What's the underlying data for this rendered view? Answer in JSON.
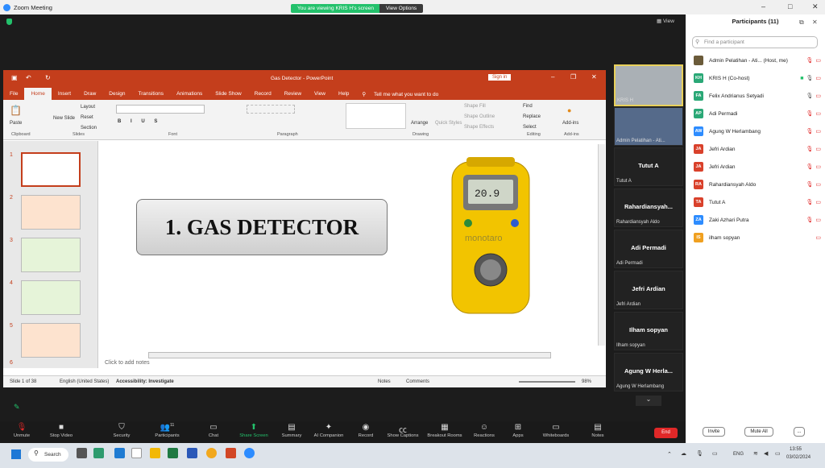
{
  "zoom": {
    "window_title": "Zoom Meeting",
    "banner": "You are viewing KRIS H's screen",
    "view_options": "View Options",
    "view_label": "View"
  },
  "ppt": {
    "title": "Gas Detector - PowerPoint",
    "sign_in": "Sign in",
    "tell_me": "Tell me what you want to do",
    "tabs": [
      "File",
      "Home",
      "Insert",
      "Draw",
      "Design",
      "Transitions",
      "Animations",
      "Slide Show",
      "Record",
      "Review",
      "View",
      "Help"
    ],
    "groups": [
      "Clipboard",
      "Slides",
      "Font",
      "Paragraph",
      "Drawing",
      "Editing",
      "Add-ins"
    ],
    "buttons": {
      "paste": "Paste",
      "new_slide": "New Slide",
      "layout": "Layout",
      "reset": "Reset",
      "section": "Section",
      "arrange": "Arrange",
      "quick_styles": "Quick Styles",
      "shape_fill": "Shape Fill",
      "shape_outline": "Shape Outline",
      "shape_effects": "Shape Effects",
      "find": "Find",
      "replace": "Replace",
      "select": "Select",
      "add_ins": "Add-ins"
    },
    "slide_numbers": [
      "1",
      "2",
      "3",
      "4",
      "5",
      "6"
    ],
    "slide_title": "1. GAS DETECTOR",
    "device_reading": "20.9",
    "device_brand": "monotaro",
    "notes_placeholder": "Click to add notes",
    "status": {
      "slide": "Slide 1 of 38",
      "language": "English (United States)",
      "accessibility": "Accessibility: Investigate",
      "notes": "Notes",
      "comments": "Comments",
      "zoom": "98%"
    }
  },
  "tiles": [
    {
      "label": "KRIS H"
    },
    {
      "label": "Admin Pelatihan - Ati..."
    },
    {
      "name": "Tutut A",
      "label": "Tutut A"
    },
    {
      "name": "Rahardiansyah...",
      "label": "Rahardiansyah Aldo"
    },
    {
      "name": "Adi Permadi",
      "label": "Adi Permadi"
    },
    {
      "name": "Jefri Ardian",
      "label": "Jefri Ardian"
    },
    {
      "name": "Ilham sopyan",
      "label": "Ilham sopyan"
    },
    {
      "name": "Agung W Herla...",
      "label": "Agung W Herlambang"
    }
  ],
  "participants": {
    "title": "Participants (11)",
    "search_placeholder": "Find a participant",
    "list": [
      {
        "initials": "",
        "name": "Admin Pelatihan - Ati...  (Host, me)",
        "color": "#6b5b3a"
      },
      {
        "initials": "KH",
        "name": "KRIS H (Co-host)",
        "color": "#2aa876"
      },
      {
        "initials": "FA",
        "name": "Felix Andrianus Setyadi",
        "color": "#2aa876"
      },
      {
        "initials": "AP",
        "name": "Adi Permadi",
        "color": "#2aa876"
      },
      {
        "initials": "AW",
        "name": "Agung W Herlambang",
        "color": "#2d8cff"
      },
      {
        "initials": "JA",
        "name": "Jefri Ardian",
        "color": "#d9412b"
      },
      {
        "initials": "JA",
        "name": "Jefri Ardian",
        "color": "#d9412b"
      },
      {
        "initials": "RA",
        "name": "Rahardiansyah Aldo",
        "color": "#d9412b"
      },
      {
        "initials": "TA",
        "name": "Tutut A",
        "color": "#d9412b"
      },
      {
        "initials": "ZA",
        "name": "Zaki Azhari Putra",
        "color": "#2d8cff"
      },
      {
        "initials": "IS",
        "name": "ilham sopyan",
        "color": "#f0a020"
      }
    ],
    "invite": "Invite",
    "mute_all": "Mute All",
    "more": "..."
  },
  "toolbar": [
    {
      "label": "Unmute",
      "icon": "mic-off-icon"
    },
    {
      "label": "Stop Video",
      "icon": "video-icon"
    },
    {
      "label": "Security",
      "icon": "shield-icon"
    },
    {
      "label": "Participants",
      "icon": "people-icon",
      "count": "11"
    },
    {
      "label": "Chat",
      "icon": "chat-icon"
    },
    {
      "label": "Share Screen",
      "icon": "share-icon"
    },
    {
      "label": "Summary",
      "icon": "summary-icon"
    },
    {
      "label": "AI Companion",
      "icon": "sparkle-icon"
    },
    {
      "label": "Record",
      "icon": "record-icon"
    },
    {
      "label": "Show Captions",
      "icon": "cc-icon"
    },
    {
      "label": "Breakout Rooms",
      "icon": "rooms-icon"
    },
    {
      "label": "Reactions",
      "icon": "smile-icon"
    },
    {
      "label": "Apps",
      "icon": "apps-icon"
    },
    {
      "label": "Whiteboards",
      "icon": "whiteboard-icon"
    },
    {
      "label": "Notes",
      "icon": "notes-icon"
    }
  ],
  "end_label": "End",
  "taskbar": {
    "search": "Search",
    "lang": "ENG",
    "time": "13:55",
    "date": "03/02/2024"
  }
}
